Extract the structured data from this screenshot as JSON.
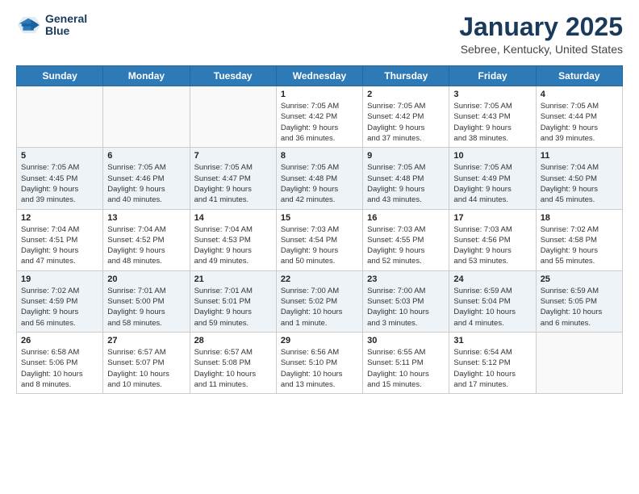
{
  "logo": {
    "line1": "General",
    "line2": "Blue"
  },
  "title": "January 2025",
  "subtitle": "Sebree, Kentucky, United States",
  "weekdays": [
    "Sunday",
    "Monday",
    "Tuesday",
    "Wednesday",
    "Thursday",
    "Friday",
    "Saturday"
  ],
  "weeks": [
    [
      {
        "day": "",
        "info": ""
      },
      {
        "day": "",
        "info": ""
      },
      {
        "day": "",
        "info": ""
      },
      {
        "day": "1",
        "info": "Sunrise: 7:05 AM\nSunset: 4:42 PM\nDaylight: 9 hours\nand 36 minutes."
      },
      {
        "day": "2",
        "info": "Sunrise: 7:05 AM\nSunset: 4:42 PM\nDaylight: 9 hours\nand 37 minutes."
      },
      {
        "day": "3",
        "info": "Sunrise: 7:05 AM\nSunset: 4:43 PM\nDaylight: 9 hours\nand 38 minutes."
      },
      {
        "day": "4",
        "info": "Sunrise: 7:05 AM\nSunset: 4:44 PM\nDaylight: 9 hours\nand 39 minutes."
      }
    ],
    [
      {
        "day": "5",
        "info": "Sunrise: 7:05 AM\nSunset: 4:45 PM\nDaylight: 9 hours\nand 39 minutes."
      },
      {
        "day": "6",
        "info": "Sunrise: 7:05 AM\nSunset: 4:46 PM\nDaylight: 9 hours\nand 40 minutes."
      },
      {
        "day": "7",
        "info": "Sunrise: 7:05 AM\nSunset: 4:47 PM\nDaylight: 9 hours\nand 41 minutes."
      },
      {
        "day": "8",
        "info": "Sunrise: 7:05 AM\nSunset: 4:48 PM\nDaylight: 9 hours\nand 42 minutes."
      },
      {
        "day": "9",
        "info": "Sunrise: 7:05 AM\nSunset: 4:48 PM\nDaylight: 9 hours\nand 43 minutes."
      },
      {
        "day": "10",
        "info": "Sunrise: 7:05 AM\nSunset: 4:49 PM\nDaylight: 9 hours\nand 44 minutes."
      },
      {
        "day": "11",
        "info": "Sunrise: 7:04 AM\nSunset: 4:50 PM\nDaylight: 9 hours\nand 45 minutes."
      }
    ],
    [
      {
        "day": "12",
        "info": "Sunrise: 7:04 AM\nSunset: 4:51 PM\nDaylight: 9 hours\nand 47 minutes."
      },
      {
        "day": "13",
        "info": "Sunrise: 7:04 AM\nSunset: 4:52 PM\nDaylight: 9 hours\nand 48 minutes."
      },
      {
        "day": "14",
        "info": "Sunrise: 7:04 AM\nSunset: 4:53 PM\nDaylight: 9 hours\nand 49 minutes."
      },
      {
        "day": "15",
        "info": "Sunrise: 7:03 AM\nSunset: 4:54 PM\nDaylight: 9 hours\nand 50 minutes."
      },
      {
        "day": "16",
        "info": "Sunrise: 7:03 AM\nSunset: 4:55 PM\nDaylight: 9 hours\nand 52 minutes."
      },
      {
        "day": "17",
        "info": "Sunrise: 7:03 AM\nSunset: 4:56 PM\nDaylight: 9 hours\nand 53 minutes."
      },
      {
        "day": "18",
        "info": "Sunrise: 7:02 AM\nSunset: 4:58 PM\nDaylight: 9 hours\nand 55 minutes."
      }
    ],
    [
      {
        "day": "19",
        "info": "Sunrise: 7:02 AM\nSunset: 4:59 PM\nDaylight: 9 hours\nand 56 minutes."
      },
      {
        "day": "20",
        "info": "Sunrise: 7:01 AM\nSunset: 5:00 PM\nDaylight: 9 hours\nand 58 minutes."
      },
      {
        "day": "21",
        "info": "Sunrise: 7:01 AM\nSunset: 5:01 PM\nDaylight: 9 hours\nand 59 minutes."
      },
      {
        "day": "22",
        "info": "Sunrise: 7:00 AM\nSunset: 5:02 PM\nDaylight: 10 hours\nand 1 minute."
      },
      {
        "day": "23",
        "info": "Sunrise: 7:00 AM\nSunset: 5:03 PM\nDaylight: 10 hours\nand 3 minutes."
      },
      {
        "day": "24",
        "info": "Sunrise: 6:59 AM\nSunset: 5:04 PM\nDaylight: 10 hours\nand 4 minutes."
      },
      {
        "day": "25",
        "info": "Sunrise: 6:59 AM\nSunset: 5:05 PM\nDaylight: 10 hours\nand 6 minutes."
      }
    ],
    [
      {
        "day": "26",
        "info": "Sunrise: 6:58 AM\nSunset: 5:06 PM\nDaylight: 10 hours\nand 8 minutes."
      },
      {
        "day": "27",
        "info": "Sunrise: 6:57 AM\nSunset: 5:07 PM\nDaylight: 10 hours\nand 10 minutes."
      },
      {
        "day": "28",
        "info": "Sunrise: 6:57 AM\nSunset: 5:08 PM\nDaylight: 10 hours\nand 11 minutes."
      },
      {
        "day": "29",
        "info": "Sunrise: 6:56 AM\nSunset: 5:10 PM\nDaylight: 10 hours\nand 13 minutes."
      },
      {
        "day": "30",
        "info": "Sunrise: 6:55 AM\nSunset: 5:11 PM\nDaylight: 10 hours\nand 15 minutes."
      },
      {
        "day": "31",
        "info": "Sunrise: 6:54 AM\nSunset: 5:12 PM\nDaylight: 10 hours\nand 17 minutes."
      },
      {
        "day": "",
        "info": ""
      }
    ]
  ]
}
